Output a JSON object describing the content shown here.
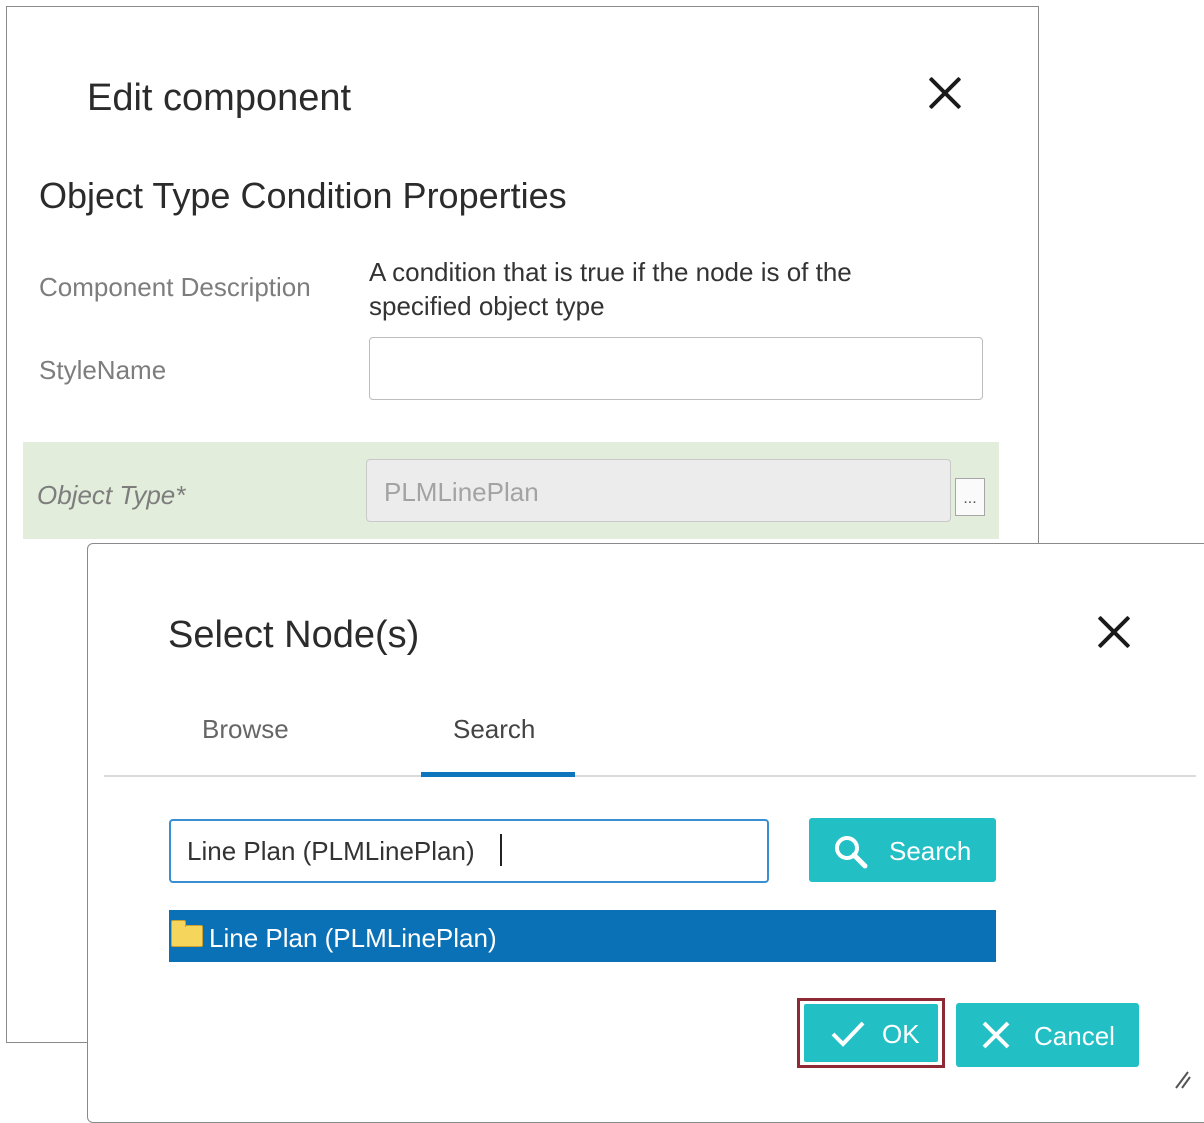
{
  "edit_dialog": {
    "title": "Edit component",
    "section_title": "Object Type Condition Properties",
    "fields": {
      "description_label": "Component Description",
      "description_value": "A condition that is true if the node is of the specified object type",
      "stylename_label": "StyleName",
      "stylename_value": "",
      "object_type_label": "Object Type*",
      "object_type_value": "PLMLinePlan",
      "ellipsis_label": "..."
    }
  },
  "select_dialog": {
    "title": "Select Node(s)",
    "tabs": [
      {
        "label": "Browse",
        "active": false
      },
      {
        "label": "Search",
        "active": true
      }
    ],
    "search": {
      "value": "Line Plan (PLMLinePlan)",
      "button_label": "Search"
    },
    "results": [
      {
        "label": "Line Plan (PLMLinePlan)",
        "selected": true,
        "icon": "folder-icon"
      }
    ],
    "buttons": {
      "ok_label": "OK",
      "cancel_label": "Cancel"
    }
  },
  "colors": {
    "accent_teal": "#22bfc5",
    "selection_blue": "#0b71b7",
    "tab_underline": "#0f75bc",
    "required_row_bg": "#e2eddb",
    "ok_highlight": "#8e2a33"
  }
}
